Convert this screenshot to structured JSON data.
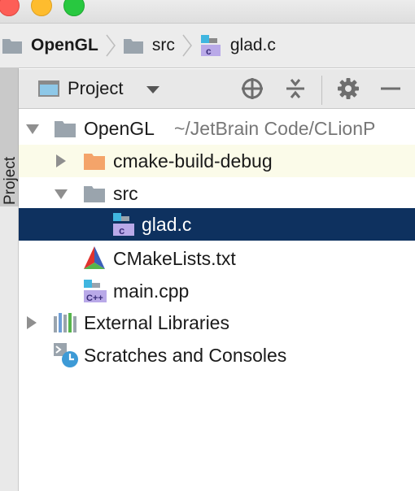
{
  "breadcrumb": {
    "items": [
      "OpenGL",
      "src",
      "glad.c"
    ]
  },
  "side_tab": {
    "label": "1: Project"
  },
  "project_toolbar": {
    "title": "Project"
  },
  "tree": {
    "root": {
      "name": "OpenGL",
      "path": "~/JetBrain Code/CLionP"
    },
    "items": [
      {
        "name": "cmake-build-debug"
      },
      {
        "name": "src"
      },
      {
        "name": "glad.c"
      },
      {
        "name": "CMakeLists.txt"
      },
      {
        "name": "main.cpp"
      },
      {
        "name": "External Libraries"
      },
      {
        "name": "Scratches and Consoles"
      }
    ]
  },
  "colors": {
    "selection": "#0e315f",
    "highlight_row": "#fbfbe9",
    "folder_gray": "#9aa4ad",
    "folder_orange": "#f4a46a",
    "c_file_purple": "#b9a9e8"
  },
  "icons": [
    "folder-icon",
    "c-file-icon",
    "cmake-icon",
    "cpp-file-icon",
    "library-icon",
    "scratch-icon",
    "target-icon",
    "collapse-icon",
    "gear-icon",
    "minimize-icon"
  ]
}
